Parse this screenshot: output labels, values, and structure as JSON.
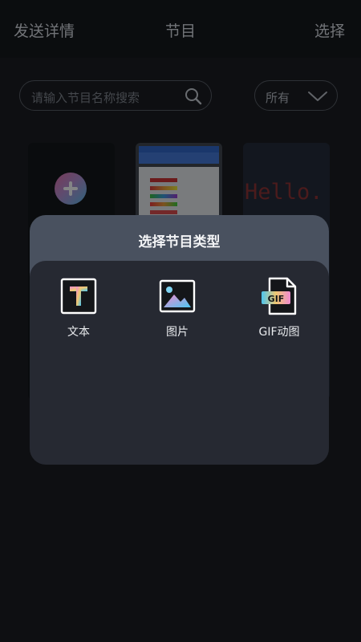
{
  "header": {
    "left_label": "发送详情",
    "title": "节目",
    "right_label": "选择"
  },
  "search": {
    "placeholder": "请输入节目名称搜索",
    "icon": "search-icon"
  },
  "filter": {
    "selected": "所有",
    "icon": "chevron-down-icon"
  },
  "programs": {
    "add_icon": "plus-circle-icon",
    "hello_preview_text": "Hello."
  },
  "dialog": {
    "title": "选择节目类型",
    "options": [
      {
        "label": "文本",
        "icon": "text-icon"
      },
      {
        "label": "图片",
        "icon": "image-icon"
      },
      {
        "label": "GIF动图",
        "icon": "gif-icon"
      }
    ]
  },
  "colors": {
    "background": "#121317",
    "sheet_header": "#49515f",
    "sheet_body": "#262932",
    "accent_gradient_start": "#f08bd0",
    "accent_gradient_end": "#4cc6f0"
  }
}
